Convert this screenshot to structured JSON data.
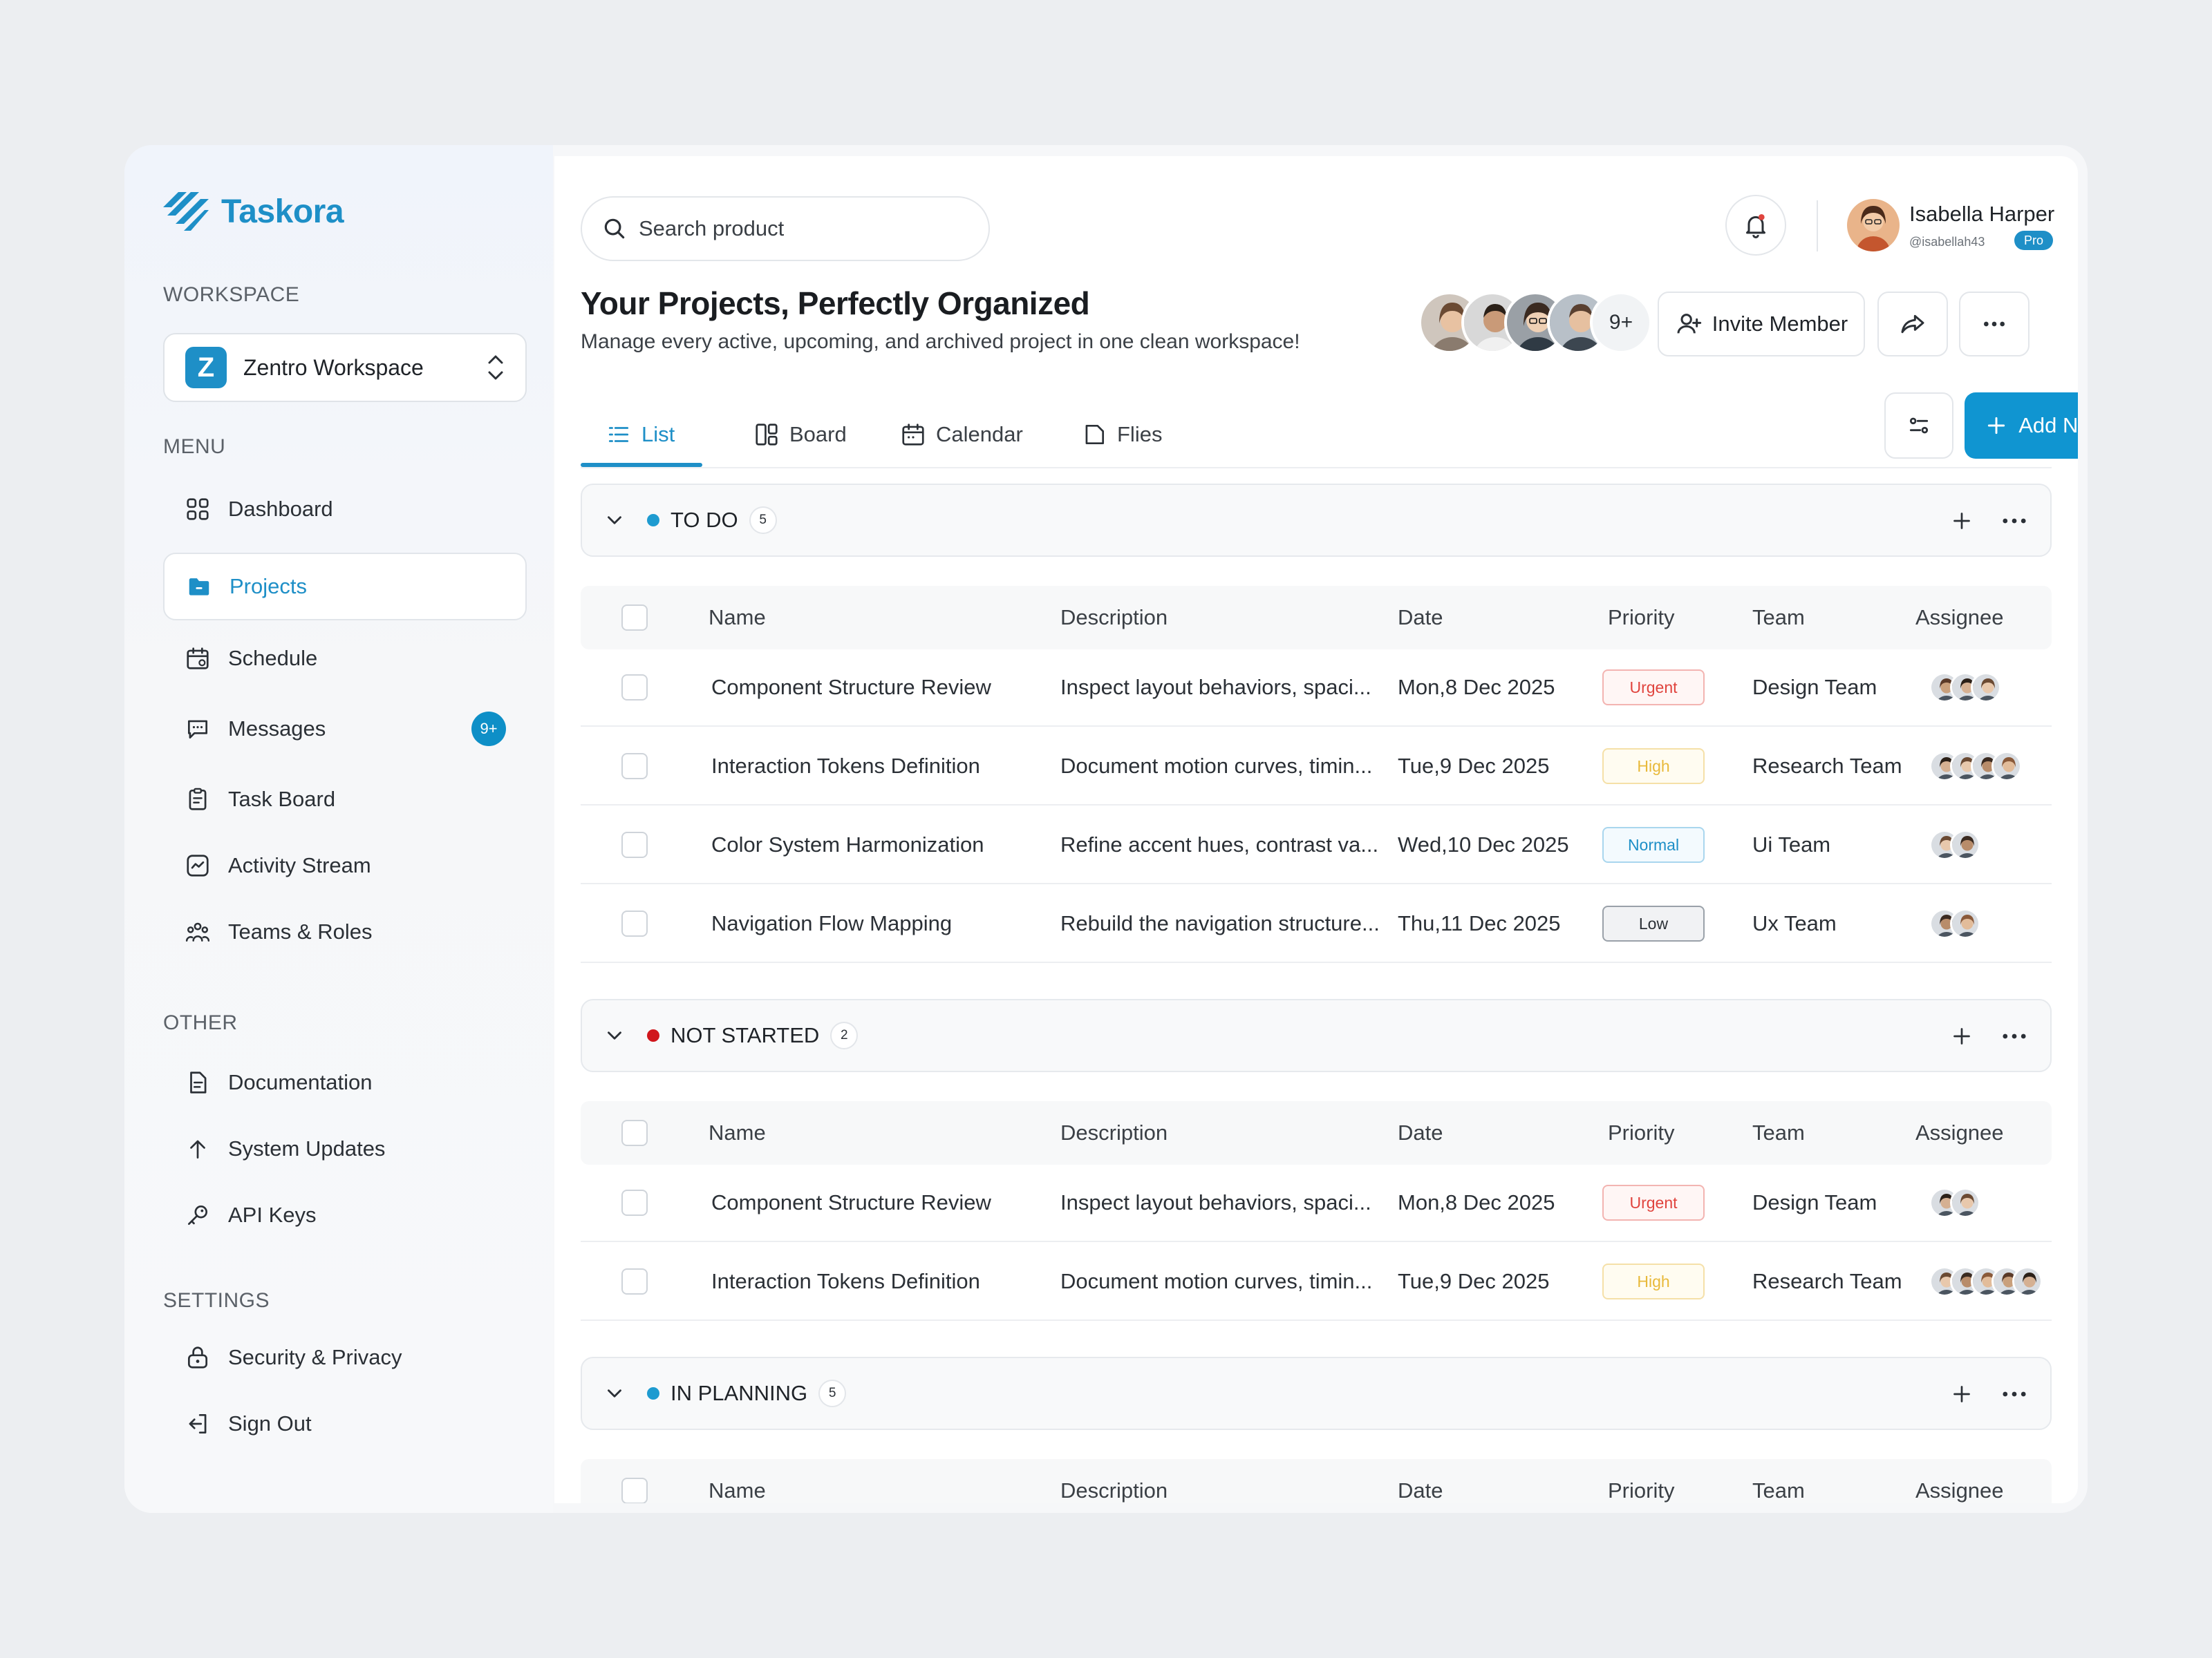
{
  "brand": {
    "name": "Taskora",
    "accent": "#1e8fc7"
  },
  "sidebar": {
    "workspace_label": "WORKSPACE",
    "workspace": {
      "badge": "Z",
      "name": "Zentro Workspace"
    },
    "menu_label": "MENU",
    "menu": [
      {
        "label": "Dashboard",
        "icon": "dashboard-icon"
      },
      {
        "label": "Projects",
        "icon": "folder-icon",
        "active": true
      },
      {
        "label": "Schedule",
        "icon": "calendar-icon"
      },
      {
        "label": "Messages",
        "icon": "message-icon",
        "badge": "9+"
      },
      {
        "label": "Task Board",
        "icon": "clipboard-icon"
      },
      {
        "label": "Activity Stream",
        "icon": "activity-icon"
      },
      {
        "label": "Teams & Roles",
        "icon": "team-icon"
      }
    ],
    "other_label": "OTHER",
    "other": [
      {
        "label": "Documentation",
        "icon": "document-icon"
      },
      {
        "label": "System Updates",
        "icon": "arrow-up-icon"
      },
      {
        "label": "API Keys",
        "icon": "key-icon"
      }
    ],
    "settings_label": "SETTINGS",
    "settings": [
      {
        "label": "Security & Privacy",
        "icon": "lock-icon"
      },
      {
        "label": "Sign Out",
        "icon": "sign-out-icon"
      }
    ]
  },
  "header": {
    "search_placeholder": "Search product",
    "user": {
      "name": "Isabella Harper",
      "handle": "@isabellah43",
      "plan": "Pro"
    }
  },
  "page": {
    "title": "Your Projects, Perfectly Organized",
    "subtitle": "Manage every active, upcoming, and archived project in one clean workspace!",
    "members_more": "9+",
    "invite_label": "Invite Member",
    "add_task_label": "Add New Task"
  },
  "tabs": [
    {
      "label": "List",
      "icon": "list-icon",
      "active": true
    },
    {
      "label": "Board",
      "icon": "board-icon"
    },
    {
      "label": "Calendar",
      "icon": "calendar-icon"
    },
    {
      "label": "Flies",
      "icon": "file-icon"
    }
  ],
  "columns": [
    "Name",
    "Description",
    "Date",
    "Priority",
    "Team",
    "Assignee"
  ],
  "priority_styles": {
    "Urgent": {
      "color": "#e0443e",
      "border": "#f3b4b1",
      "bg": "#fff6f5"
    },
    "High": {
      "color": "#e8b93a",
      "border": "#f5e0a8",
      "bg": "#fffcf1"
    },
    "Normal": {
      "color": "#1e8fc7",
      "border": "#a9d6ee",
      "bg": "#f3fafe"
    },
    "Low": {
      "color": "#2b3036",
      "border": "#9aa1a9",
      "bg": "#f1f2f4"
    }
  },
  "groups": [
    {
      "name": "TO DO",
      "count": "5",
      "color": "#1e9bd0",
      "rows": [
        {
          "name": "Component Structure Review",
          "description": "Inspect layout behaviors, spaci...",
          "date": "Mon,8 Dec 2025",
          "priority": "Urgent",
          "team": "Design Team",
          "assignees": 3
        },
        {
          "name": "Interaction Tokens Definition",
          "description": "Document motion curves, timin...",
          "date": "Tue,9 Dec 2025",
          "priority": "High",
          "team": "Research Team",
          "assignees": 4
        },
        {
          "name": "Color System Harmonization",
          "description": "Refine accent hues, contrast va...",
          "date": "Wed,10 Dec 2025",
          "priority": "Normal",
          "team": "Ui Team",
          "assignees": 2
        },
        {
          "name": "Navigation Flow Mapping",
          "description": "Rebuild the navigation structure...",
          "date": "Thu,11 Dec 2025",
          "priority": "Low",
          "team": "Ux Team",
          "assignees": 2
        }
      ]
    },
    {
      "name": "NOT STARTED",
      "count": "2",
      "color": "#d0161c",
      "rows": [
        {
          "name": "Component Structure Review",
          "description": "Inspect layout behaviors, spaci...",
          "date": "Mon,8 Dec 2025",
          "priority": "Urgent",
          "team": "Design Team",
          "assignees": 2
        },
        {
          "name": "Interaction Tokens Definition",
          "description": "Document motion curves, timin...",
          "date": "Tue,9 Dec 2025",
          "priority": "High",
          "team": "Research Team",
          "assignees": 5
        }
      ]
    },
    {
      "name": "IN PLANNING",
      "count": "5",
      "color": "#1e9bd0",
      "rows": []
    }
  ]
}
